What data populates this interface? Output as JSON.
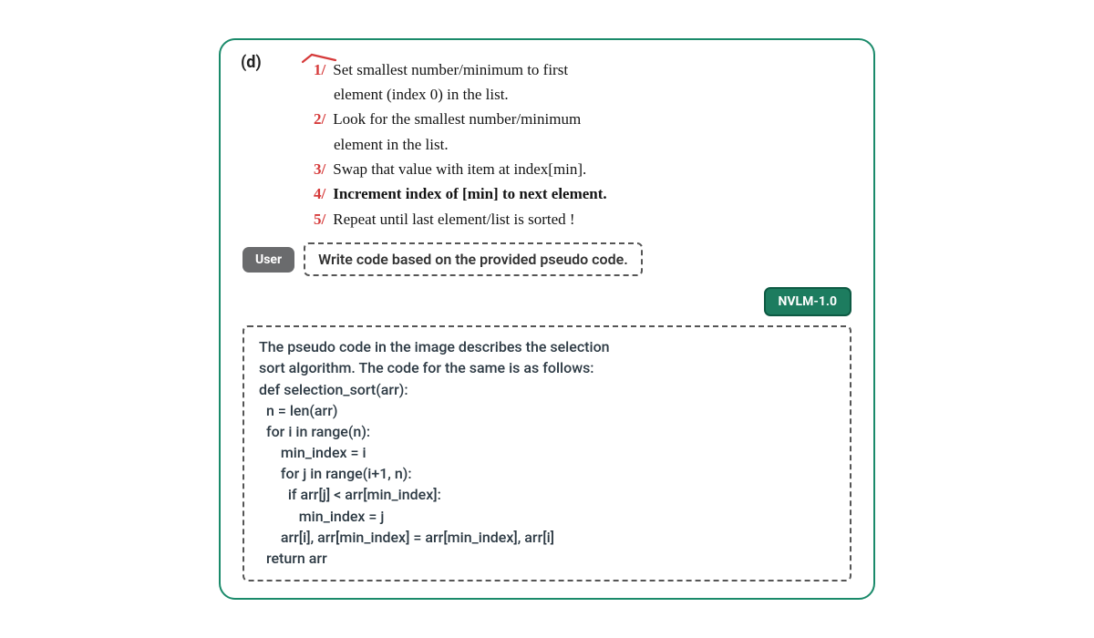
{
  "panel": {
    "label": "(d)"
  },
  "handwriting": {
    "lines": [
      {
        "num": "1/",
        "text": "Set smallest number/minimum to first",
        "indent": false
      },
      {
        "num": "",
        "text": "element (index 0) in the list.",
        "indent": true
      },
      {
        "num": "2/",
        "text": "Look for the smallest number/minimum",
        "indent": false
      },
      {
        "num": "",
        "text": "element in the list.",
        "indent": true
      },
      {
        "num": "3/",
        "text": "Swap that value with item at index[min].",
        "indent": false
      },
      {
        "num": "4/",
        "text": "Increment index of [min] to next element.",
        "indent": false
      },
      {
        "num": "5/",
        "text": "Repeat until last element/list is sorted !",
        "indent": false
      }
    ]
  },
  "user": {
    "badge": "User",
    "prompt": "Write code based on the provided pseudo code."
  },
  "model": {
    "badge": "NVLM-1.0",
    "response": "The pseudo code in the image describes the selection\nsort algorithm. The code for the same is as follows:\ndef selection_sort(arr):\n  n = len(arr)\n  for i in range(n):\n      min_index = i\n      for j in range(i+1, n):\n        if arr[j] < arr[min_index]:\n           min_index = j\n      arr[i], arr[min_index] = arr[min_index], arr[i]\n  return arr"
  }
}
